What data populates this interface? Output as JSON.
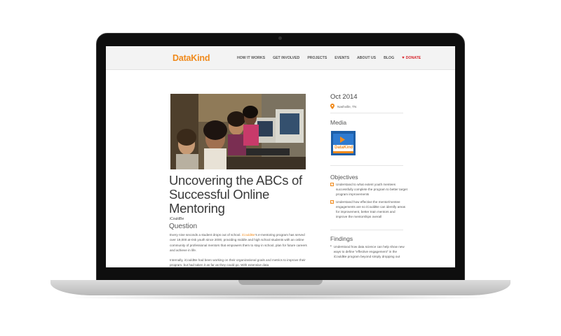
{
  "nav": {
    "logo": "DataKind",
    "links": [
      "HOW IT WORKS",
      "GET INVOLVED",
      "PROJECTS",
      "EVENTS",
      "ABOUT US",
      "BLOG"
    ],
    "donate": "DONATE"
  },
  "article": {
    "title": "Uncovering the ABCs of Successful Online Mentoring",
    "subtitle": "iCouldBe",
    "question_heading": "Question",
    "p1_before": "Every nine seconds a student drops out of school. ",
    "p1_link": "iCouldBe",
    "p1_after": "'s e-mentoring program has served over 19,000 at-risk youth since 2000, providing middle and high school students with an online community of professional mentors that empowers them to stay in school, plan for future careers and achieve in life.",
    "p2": "Internally, iCouldBe had been working on their organizational goals and metrics to improve their program, but had taken it as far as they could go. With extensive data"
  },
  "sidebar": {
    "date": "Oct 2014",
    "location": "Nashville, TN",
    "media_heading": "Media",
    "media_thumb_label": "DataKind",
    "objectives_heading": "Objectives",
    "objectives": [
      "Understand to what extent youth mentees successfully complete the program to better target program improvements",
      "Understand how effective the mentor/mentee engagements are so iCouldBe can identify areas for improvement, better train mentors and improve the mentorships overall"
    ],
    "findings_heading": "Findings",
    "findings": [
      "Understood how data science can help show new ways to define \"effective engagement\" in the iCouldBe program beyond simply dropping out"
    ]
  },
  "colors": {
    "accent": "#f08a1c",
    "donate": "#d7262e"
  }
}
